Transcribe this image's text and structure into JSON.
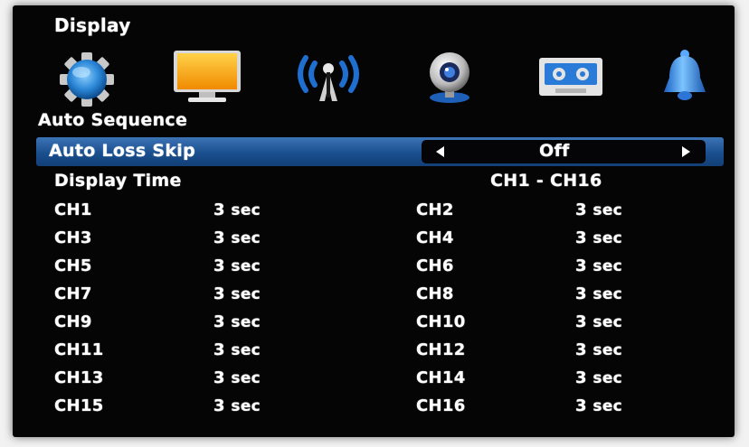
{
  "menu": {
    "title": "Display",
    "icons": [
      {
        "name": "settings-gear-icon",
        "selected": false
      },
      {
        "name": "display-monitor-icon",
        "selected": true
      },
      {
        "name": "network-antenna-icon",
        "selected": false
      },
      {
        "name": "camera-icon",
        "selected": false
      },
      {
        "name": "recording-tape-icon",
        "selected": false
      },
      {
        "name": "alarm-bell-icon",
        "selected": false
      }
    ]
  },
  "auto_sequence": {
    "heading": "Auto Sequence",
    "auto_loss_skip": {
      "label": "Auto Loss Skip",
      "value": "Off"
    },
    "display_time": {
      "label": "Display Time",
      "range": "CH1 - CH16"
    },
    "channels": [
      {
        "name": "CH1",
        "num": "3",
        "unit": "sec"
      },
      {
        "name": "CH2",
        "num": "3",
        "unit": "sec"
      },
      {
        "name": "CH3",
        "num": "3",
        "unit": "sec"
      },
      {
        "name": "CH4",
        "num": "3",
        "unit": "sec"
      },
      {
        "name": "CH5",
        "num": "3",
        "unit": "sec"
      },
      {
        "name": "CH6",
        "num": "3",
        "unit": "sec"
      },
      {
        "name": "CH7",
        "num": "3",
        "unit": "sec"
      },
      {
        "name": "CH8",
        "num": "3",
        "unit": "sec"
      },
      {
        "name": "CH9",
        "num": "3",
        "unit": "sec"
      },
      {
        "name": "CH10",
        "num": "3",
        "unit": "sec"
      },
      {
        "name": "CH11",
        "num": "3",
        "unit": "sec"
      },
      {
        "name": "CH12",
        "num": "3",
        "unit": "sec"
      },
      {
        "name": "CH13",
        "num": "3",
        "unit": "sec"
      },
      {
        "name": "CH14",
        "num": "3",
        "unit": "sec"
      },
      {
        "name": "CH15",
        "num": "3",
        "unit": "sec"
      },
      {
        "name": "CH16",
        "num": "3",
        "unit": "sec"
      }
    ]
  }
}
